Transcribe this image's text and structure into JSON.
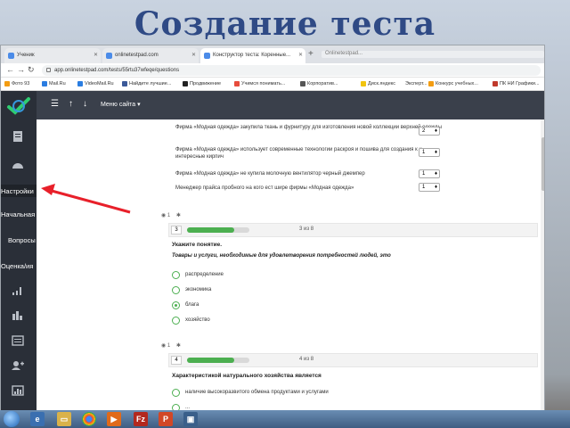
{
  "slide": {
    "title": "Создание теста"
  },
  "browser": {
    "tabs": [
      {
        "label": "Ученик"
      },
      {
        "label": "onlinetestpad.com"
      },
      {
        "label": "Конструктор теста: Коренные..."
      }
    ],
    "ghost_tab": "Onlinetestpad...",
    "url": "app.onlinetestpad.com/tests/55rtu37wfeqe/questions",
    "bookmarks": [
      "Фото 93",
      "Mail.Ru",
      "VideoMail.Ru",
      "Найдите лучшие...",
      "Продвижение",
      "Учимся понимать...",
      "Корпоратив...",
      "Диск.яндекс",
      "Эксперт...",
      "Конкурс учебных...",
      "ПК НИ Графики..."
    ]
  },
  "sidebar": {
    "labels": {
      "settings": "Настройки",
      "start_page": "Начальная",
      "questions": "Вопросы",
      "results": "Оценка/ия"
    }
  },
  "topbar": {
    "menu_label": "Меню сайта"
  },
  "prev_question": {
    "rows": [
      {
        "text": "Фирма «Модная одежда» закупила ткань и фурнитуру для изготовления новой коллекции верхней одежды",
        "select": "2"
      },
      {
        "text": "Фирма «Модная одежда» использует современные технологии раскроя и пошива для создания к и интересные кирпич",
        "select": "1"
      },
      {
        "text": "Фирма «Модная одежда» не купила молочную вентилятор черный джемпер",
        "select": "1"
      },
      {
        "text": "Менеджер прайса пробного на кого ест шире фирмы «Модная одежда»",
        "select": "1"
      }
    ]
  },
  "question3": {
    "meta": "1",
    "number": "3",
    "progress": 0.75,
    "of_text": "3 из 8",
    "title": "Укажите понятие.",
    "text": "Товары и услуги, необходимые для удовлетворения потребностей людей,          это",
    "options": [
      {
        "label": "распределение",
        "selected": false
      },
      {
        "label": "экономика",
        "selected": false
      },
      {
        "label": "блага",
        "selected": true
      },
      {
        "label": "хозяйство",
        "selected": false
      }
    ]
  },
  "question4": {
    "meta": "1",
    "number": "4",
    "progress": 0.75,
    "of_text": "4 из 8",
    "title": "Характеристикой натурального хозяйства является",
    "options": [
      {
        "label": "наличие высокоразвитого обмена продуктами и услугами",
        "selected": false
      },
      {
        "label": "...",
        "selected": false
      }
    ]
  },
  "colors": {
    "accent": "#4caf50",
    "sidebar": "#2a2f38",
    "topbar": "#3a404b",
    "title": "#2f4a85",
    "arrow": "#e8202a"
  },
  "icons": [
    "menu-icon",
    "up-icon",
    "down-icon",
    "document-icon",
    "dashboard-icon",
    "chart-icon",
    "bar-chart-icon",
    "list-icon",
    "user-add-icon",
    "grid-icon"
  ]
}
